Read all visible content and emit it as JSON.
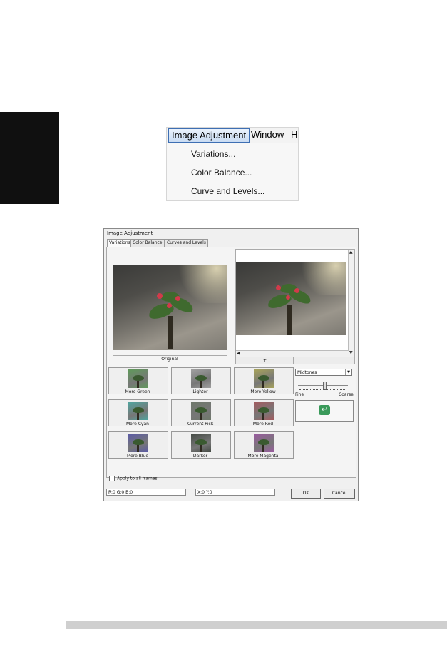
{
  "menu": {
    "bar": [
      "Image Adjustment",
      "Window",
      "H"
    ],
    "items": [
      "Variations...",
      "Color Balance...",
      "Curve and Levels..."
    ]
  },
  "dialog": {
    "title": "Image Adjustment",
    "tabs": [
      "Variations",
      "Color Balance",
      "Curves and Levels"
    ],
    "original_label": "Original",
    "preview_label": "+",
    "variations": [
      {
        "label": "More Green",
        "tint": "#5f9a5a"
      },
      {
        "label": "Lighter",
        "tint": "#a0a0a0"
      },
      {
        "label": "More Yellow",
        "tint": "#a8a45a"
      },
      {
        "label": "More Cyan",
        "tint": "#4fa6a0"
      },
      {
        "label": "Current Pick",
        "tint": "#6e786a"
      },
      {
        "label": "More Red",
        "tint": "#a45a5e"
      },
      {
        "label": "More Blue",
        "tint": "#5a5aa6"
      },
      {
        "label": "Darker",
        "tint": "#444a44"
      },
      {
        "label": "More Magenta",
        "tint": "#9a5aa0"
      }
    ],
    "tone_select": "Midtones",
    "slider_min_label": "Fine",
    "slider_max_label": "Coarse",
    "undo_icon": "undo-arrow-icon",
    "apply_all_label": "Apply to all frames",
    "status_rgb": "R:0 G:0 B:0",
    "status_xy": "X:0 Y:0",
    "ok_label": "OK",
    "cancel_label": "Cancel"
  }
}
